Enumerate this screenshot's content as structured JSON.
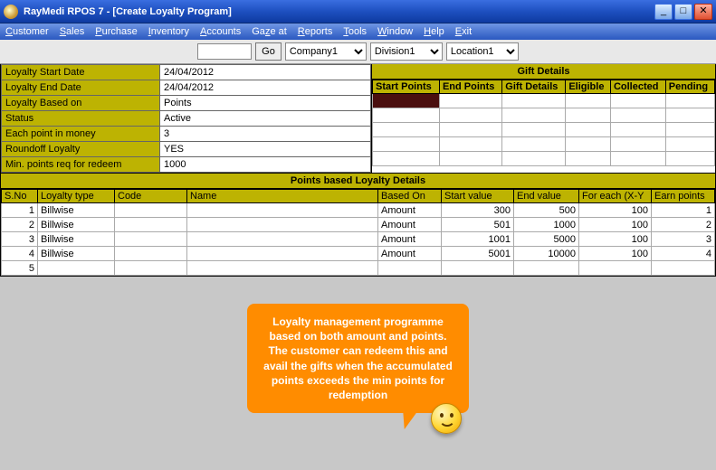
{
  "window": {
    "title": "RayMedi RPOS 7 - [Create Loyalty Program]"
  },
  "menu": {
    "items": [
      "Customer",
      "Sales",
      "Purchase",
      "Inventory",
      "Accounts",
      "Gaze at",
      "Reports",
      "Tools",
      "Window",
      "Help",
      "Exit"
    ]
  },
  "toolbar": {
    "search_value": "",
    "go_label": "Go",
    "company": {
      "selected": "Company1"
    },
    "division": {
      "selected": "Division1"
    },
    "location": {
      "selected": "Location1"
    }
  },
  "loyalty_form": {
    "rows": [
      {
        "label": "Loyalty Start Date",
        "value": "24/04/2012"
      },
      {
        "label": "Loyalty End Date",
        "value": "24/04/2012"
      },
      {
        "label": "Loyalty Based on",
        "value": "Points"
      },
      {
        "label": "Status",
        "value": "Active"
      },
      {
        "label": "Each point in money",
        "value": "3"
      },
      {
        "label": "Roundoff Loyalty",
        "value": "YES"
      },
      {
        "label": "Min. points req for redeem",
        "value": "1000"
      }
    ]
  },
  "gift": {
    "title": "Gift Details",
    "columns": [
      "Start Points",
      "End Points",
      "Gift Details",
      "Eligible",
      "Collected",
      "Pending"
    ]
  },
  "points": {
    "title": "Points based Loyalty Details",
    "columns": [
      "S.No",
      "Loyalty type",
      "Code",
      "Name",
      "Based On",
      "Start value",
      "End value",
      "For each (X-Y",
      "Earn points"
    ],
    "rows": [
      {
        "sno": "1",
        "type": "Billwise",
        "code": "",
        "name": "",
        "based": "Amount",
        "start": "300",
        "end": "500",
        "foreach": "100",
        "earn": "1"
      },
      {
        "sno": "2",
        "type": "Billwise",
        "code": "",
        "name": "",
        "based": "Amount",
        "start": "501",
        "end": "1000",
        "foreach": "100",
        "earn": "2"
      },
      {
        "sno": "3",
        "type": "Billwise",
        "code": "",
        "name": "",
        "based": "Amount",
        "start": "1001",
        "end": "5000",
        "foreach": "100",
        "earn": "3"
      },
      {
        "sno": "4",
        "type": "Billwise",
        "code": "",
        "name": "",
        "based": "Amount",
        "start": "5001",
        "end": "10000",
        "foreach": "100",
        "earn": "4"
      },
      {
        "sno": "5",
        "type": "",
        "code": "",
        "name": "",
        "based": "",
        "start": "",
        "end": "",
        "foreach": "",
        "earn": ""
      }
    ]
  },
  "callout": {
    "text": "Loyalty management programme based on both amount and points. The customer can redeem this and avail the gifts when the accumulated points exceeds the min points for redemption"
  }
}
